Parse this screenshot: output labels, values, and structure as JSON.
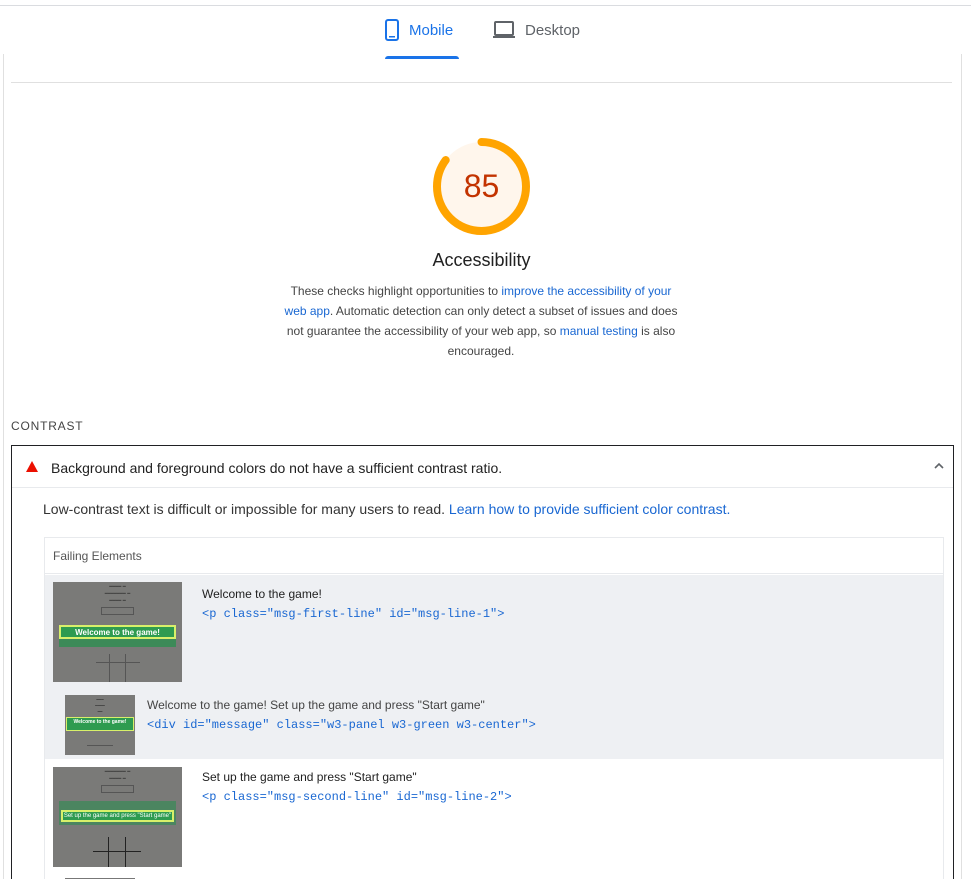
{
  "tabs": {
    "mobile": "Mobile",
    "desktop": "Desktop",
    "active": "mobile",
    "accent_color": "#1a73e8"
  },
  "category": {
    "score": "85",
    "score_fraction": 0.85,
    "gauge_color": "#ffa400",
    "score_color": "#c33300",
    "title": "Accessibility",
    "desc": {
      "part1": "These checks highlight opportunities to ",
      "link1": "improve the accessibility of your web app",
      "part2": ". Automatic detection can only detect a subset of issues and does not guarantee the accessibility of your web app, so ",
      "link2": "manual testing",
      "part3": " is also encouraged."
    }
  },
  "group": {
    "title": "CONTRAST"
  },
  "audit": {
    "status_icon": "fail-triangle-icon",
    "title": "Background and foreground colors do not have a sufficient contrast ratio.",
    "expanded_icon": "chevron-up-icon",
    "desc_text": "Low-contrast text is difficult or impossible for many users to read. ",
    "desc_link": "Learn how to provide sufficient color contrast.",
    "table_header": "Failing Elements",
    "items": [
      {
        "label": "Welcome to the game!",
        "snippet": "<p class=\"msg-first-line\" id=\"msg-line-1\">",
        "thumb_text": "Welcome to the game!"
      },
      {
        "label": "Welcome to the game! Set up the game and press \"Start game\"",
        "snippet": "<div id=\"message\" class=\"w3-panel w3-green w3-center\">",
        "thumb_text": "Welcome to the game!"
      },
      {
        "label": "Set up the game and press \"Start game\"",
        "snippet": "<p class=\"msg-second-line\" id=\"msg-line-2\">",
        "thumb_text": "Set up the game and press \"Start game\""
      }
    ]
  }
}
